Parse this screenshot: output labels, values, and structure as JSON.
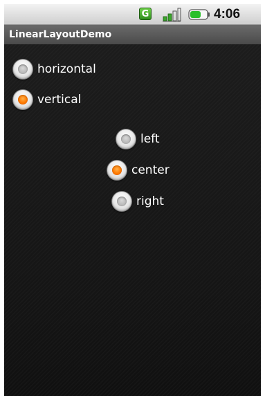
{
  "status_bar": {
    "network_badge": "G",
    "time": "4:06 PM",
    "icons": [
      "network-g-icon",
      "signal-icon",
      "battery-icon"
    ],
    "battery_color": "#2bbf2b"
  },
  "app": {
    "title": "LinearLayoutDemo"
  },
  "orientation_group": {
    "options": [
      {
        "label": "horizontal",
        "checked": false
      },
      {
        "label": "vertical",
        "checked": true
      }
    ]
  },
  "gravity_group": {
    "options": [
      {
        "label": "left",
        "checked": false
      },
      {
        "label": "center",
        "checked": true
      },
      {
        "label": "right",
        "checked": false
      }
    ]
  },
  "colors": {
    "accent_checked": "#ff7a00",
    "title_bar": "#5a5a5a",
    "background": "#151515"
  }
}
